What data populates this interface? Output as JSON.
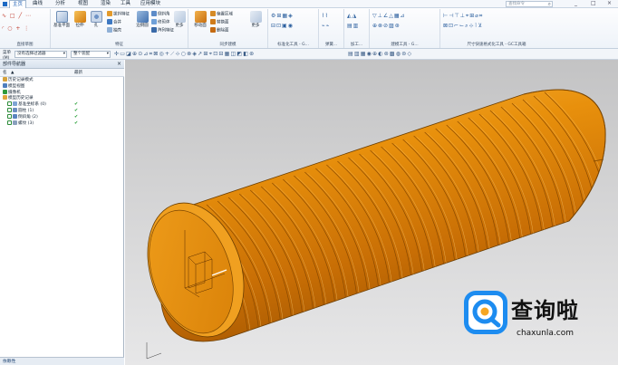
{
  "tabs": [
    "主页",
    "曲线",
    "分析",
    "视图",
    "渲染",
    "工具",
    "应用模块"
  ],
  "active_tab": "主页",
  "search_placeholder": "查找命令",
  "window_controls": [
    "_",
    "□",
    "×"
  ],
  "ribbon": {
    "groups": [
      {
        "label": "直接草图"
      },
      {
        "label": "特征"
      },
      {
        "label": "同步建模"
      },
      {
        "label": "标准化工具 - G..."
      },
      {
        "label": "弹簧..."
      },
      {
        "label": "加工..."
      },
      {
        "label": "建模工具 - G..."
      },
      {
        "label": "尺寸快速格式化工具 - GC工具箱"
      }
    ],
    "big_buttons": [
      {
        "label": "基准平面"
      },
      {
        "label": "拉伸"
      },
      {
        "label": "孔"
      },
      {
        "label": "边倒圆"
      },
      {
        "label": "更多"
      },
      {
        "label": "移动面"
      },
      {
        "label": "更多"
      }
    ],
    "small_items": [
      "拔斜特征",
      "合并",
      "抽壳",
      "倒斜角",
      "修剪体",
      "阵列特征",
      "偏置区域",
      "替换面",
      "删除面"
    ]
  },
  "toolbar2": {
    "menu_label": "菜单(M)",
    "filter_value": "没有选择过滤器",
    "scope_value": "整个装配"
  },
  "navigator": {
    "title": "部件导航器",
    "close_icon": "×",
    "col_name": "名",
    "col_latest": "最新",
    "items": [
      {
        "label": "历史记录模式",
        "indent": 1,
        "check": false
      },
      {
        "label": "模型视图",
        "indent": 1,
        "check": false
      },
      {
        "label": "摄像机",
        "indent": 1,
        "check": false
      },
      {
        "label": "模型历史记录",
        "indent": 1,
        "check": false
      },
      {
        "label": "基准坐标系 (0)",
        "indent": 2,
        "check": true
      },
      {
        "label": "圆柱 (1)",
        "indent": 2,
        "check": true
      },
      {
        "label": "倒斜角 (2)",
        "indent": 2,
        "check": true
      },
      {
        "label": "螺纹 (3)",
        "indent": 2,
        "check": true
      }
    ],
    "bottom_label": "依赖性"
  },
  "watermark": {
    "title": "查询啦",
    "url": "chaxunla.com"
  },
  "colors": {
    "accent": "#1558b0",
    "model_orange": "#e8920c",
    "check_green": "#1e9a2e",
    "watermark_blue": "#1d8cf0"
  }
}
